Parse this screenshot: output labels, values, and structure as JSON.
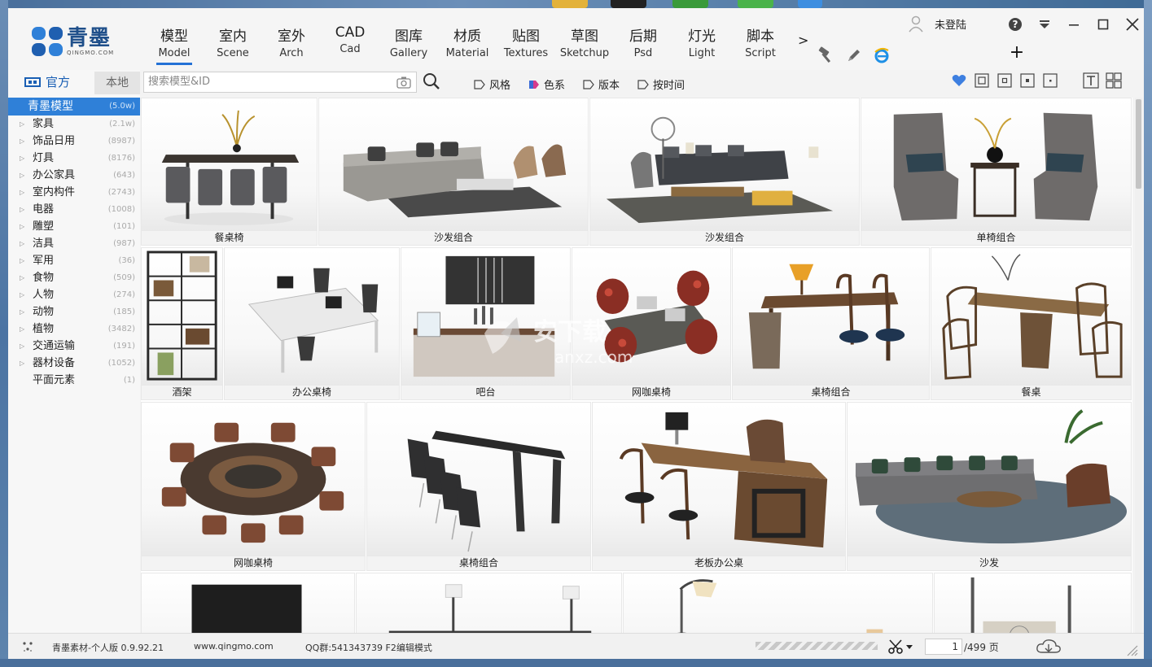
{
  "app": {
    "logo_cn": "青墨",
    "logo_en": "QINGMO.COM"
  },
  "tabs": [
    {
      "cn": "模型",
      "en": "Model",
      "active": true
    },
    {
      "cn": "室内",
      "en": "Scene"
    },
    {
      "cn": "室外",
      "en": "Arch"
    },
    {
      "cn": "CAD",
      "en": "Cad"
    },
    {
      "cn": "图库",
      "en": "Gallery"
    },
    {
      "cn": "材质",
      "en": "Material"
    },
    {
      "cn": "贴图",
      "en": "Textures"
    },
    {
      "cn": "草图",
      "en": "Sketchup"
    },
    {
      "cn": "后期",
      "en": "Psd"
    },
    {
      "cn": "灯光",
      "en": "Light"
    },
    {
      "cn": "脚本",
      "en": "Script"
    }
  ],
  "header": {
    "more": ">",
    "user_name": "未登陆",
    "plus": "+"
  },
  "sidebar": {
    "official": "官方",
    "local": "本地",
    "categories": [
      {
        "label": "青墨模型",
        "count": "(5.0w)",
        "active": true
      },
      {
        "label": "家具",
        "count": "(2.1w)"
      },
      {
        "label": "饰品日用",
        "count": "(8987)"
      },
      {
        "label": "灯具",
        "count": "(8176)"
      },
      {
        "label": "办公家具",
        "count": "(643)"
      },
      {
        "label": "室内构件",
        "count": "(2743)"
      },
      {
        "label": "电器",
        "count": "(1008)"
      },
      {
        "label": "雕塑",
        "count": "(101)"
      },
      {
        "label": "洁具",
        "count": "(987)"
      },
      {
        "label": "军用",
        "count": "(36)"
      },
      {
        "label": "食物",
        "count": "(509)"
      },
      {
        "label": "人物",
        "count": "(274)"
      },
      {
        "label": "动物",
        "count": "(185)"
      },
      {
        "label": "植物",
        "count": "(3482)"
      },
      {
        "label": "交通运输",
        "count": "(191)"
      },
      {
        "label": "器材设备",
        "count": "(1052)"
      },
      {
        "label": "平面元素",
        "count": "(1)"
      }
    ]
  },
  "search": {
    "placeholder": "搜索模型&ID",
    "value": ""
  },
  "filters": [
    "风格",
    "色系",
    "版本",
    "按时间"
  ],
  "grid": {
    "items": [
      {
        "caption": "餐桌椅"
      },
      {
        "caption": "沙发组合"
      },
      {
        "caption": "沙发组合"
      },
      {
        "caption": "单椅组合"
      },
      {
        "caption": "酒架"
      },
      {
        "caption": "办公桌椅"
      },
      {
        "caption": "吧台"
      },
      {
        "caption": "网咖桌椅"
      },
      {
        "caption": "桌椅组合"
      },
      {
        "caption": "餐桌"
      },
      {
        "caption": "网咖桌椅"
      },
      {
        "caption": "桌椅组合"
      },
      {
        "caption": "老板办公桌"
      },
      {
        "caption": "沙发"
      },
      {
        "caption": ""
      },
      {
        "caption": ""
      },
      {
        "caption": ""
      },
      {
        "caption": ""
      }
    ]
  },
  "watermark": {
    "cn": "安下载",
    "en": "anxz.com"
  },
  "status": {
    "version": "青墨素材-个人版 0.9.92.21",
    "website": "www.qingmo.com",
    "qq": "QQ群:541343739 F2编辑模式",
    "page_current": "1",
    "page_total": "/499 页"
  },
  "colors": {
    "accent": "#2f80d8",
    "tab_underline": "#2472d6",
    "heart": "#3d7fe0"
  }
}
